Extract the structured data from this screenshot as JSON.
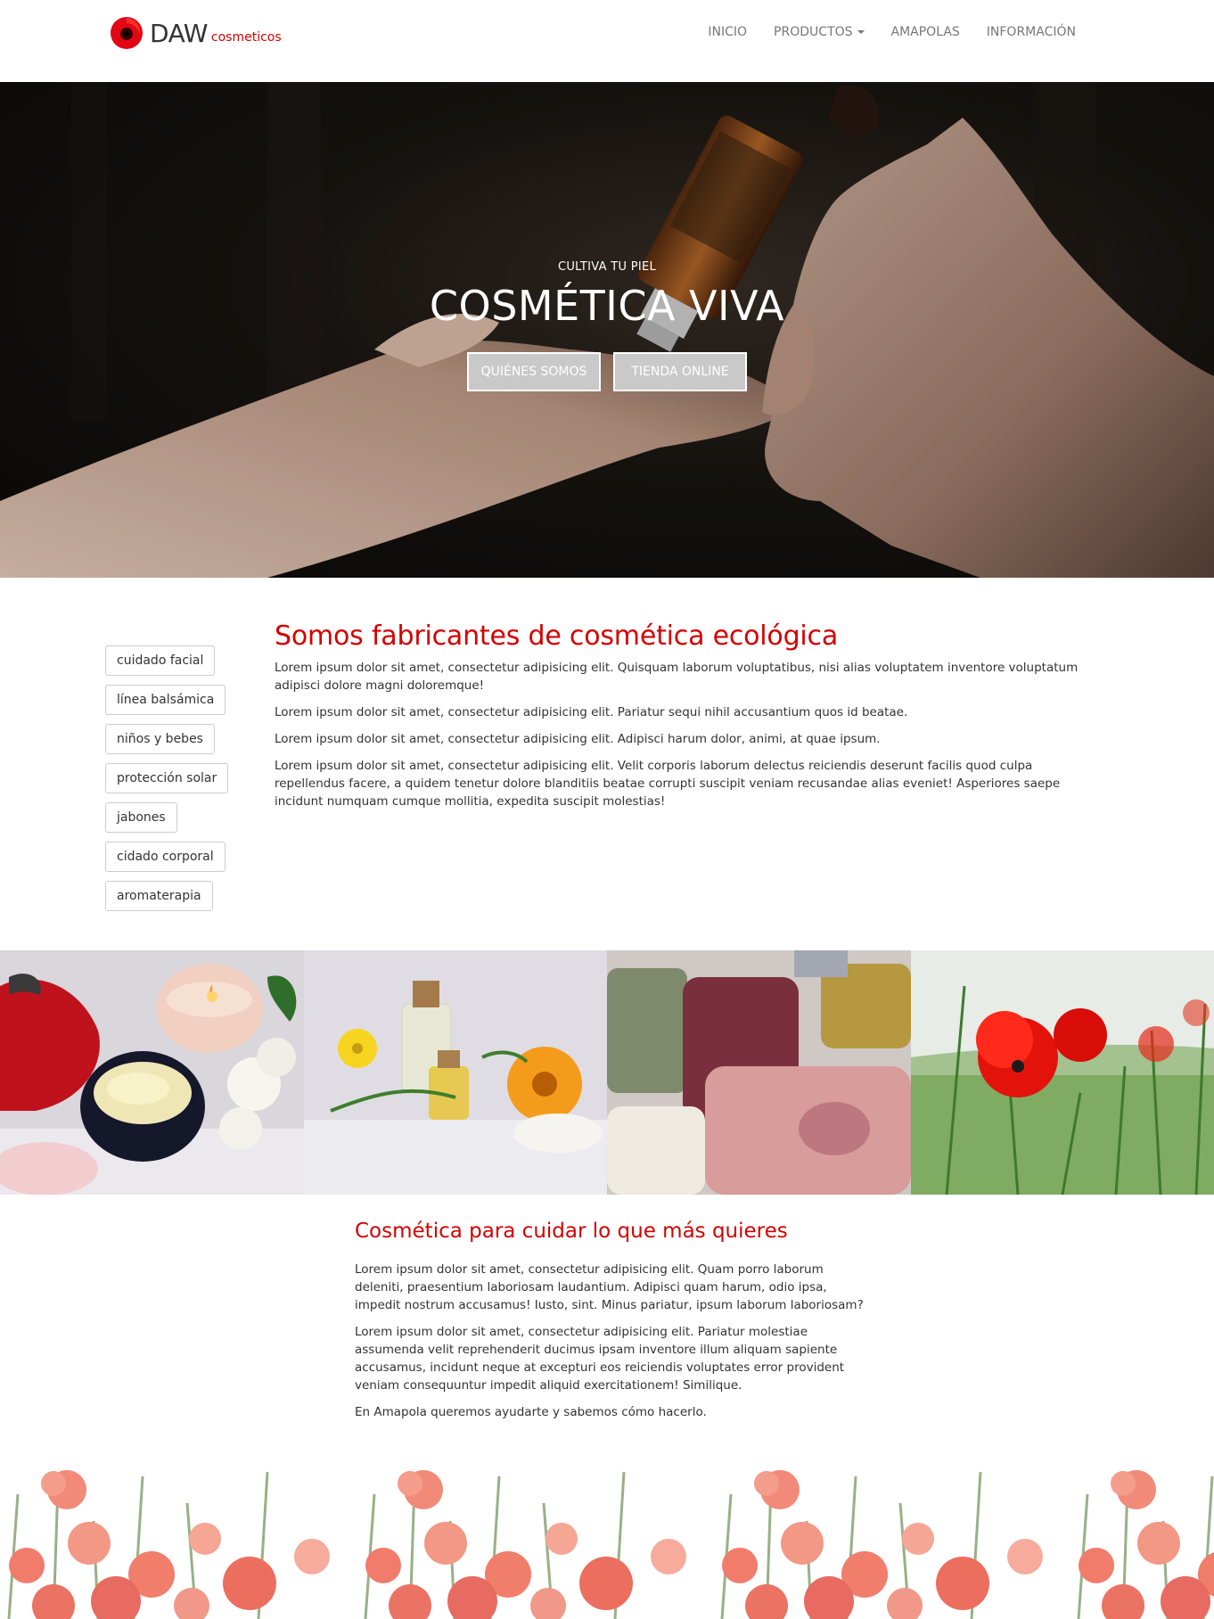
{
  "brand": {
    "name": "DAW",
    "sub": "cosmeticos"
  },
  "nav": {
    "items": [
      {
        "label": "INICIO"
      },
      {
        "label": "PRODUCTOS",
        "dropdown": true
      },
      {
        "label": "AMAPOLAS"
      },
      {
        "label": "INFORMACIÓN"
      }
    ]
  },
  "hero": {
    "kicker": "CULTIVA TU PIEL",
    "title": "COSMÉTICA VIVA",
    "buttons": [
      "QUIÉNES SOMOS",
      "TIENDA ONLINE"
    ]
  },
  "sidebar": {
    "tags": [
      "cuidado facial",
      "línea balsámica",
      "niños y bebes",
      "protección solar",
      "jabones",
      "cidado corporal",
      "aromaterapia"
    ]
  },
  "intro": {
    "title": "Somos fabricantes de cosmética ecológica",
    "paragraphs": [
      "Lorem ipsum dolor sit amet, consectetur adipisicing elit. Quisquam laborum voluptatibus, nisi alias voluptatem inventore voluptatum adipisci dolore magni doloremque!",
      "Lorem ipsum dolor sit amet, consectetur adipisicing elit. Pariatur sequi nihil accusantium quos id beatae.",
      "Lorem ipsum dolor sit amet, consectetur adipisicing elit. Adipisci harum dolor, animi, at quae ipsum.",
      "Lorem ipsum dolor sit amet, consectetur adipisicing elit. Velit corporis laborum delectus reiciendis deserunt facilis quod culpa repellendus facere, a quidem tenetur dolore blanditiis beatae corrupti suscipit veniam recusandae alias eveniet! Asperiores saepe incidunt numquam cumque mollitia, expedita suscipit molestias!"
    ]
  },
  "gallery": {
    "images": [
      "cream-jar-candle-photo",
      "calendula-oil-bottles-photo",
      "soap-bars-photo",
      "red-poppies-photo"
    ]
  },
  "cuidar": {
    "title": "Cosmética para cuidar lo que más quieres",
    "paragraphs": [
      "Lorem ipsum dolor sit amet, consectetur adipisicing elit. Quam porro laborum deleniti, praesentium laboriosam laudantium. Adipisci quam harum, odio ipsa, impedit nostrum accusamus! Iusto, sint. Minus pariatur, ipsum laborum laboriosam?",
      "Lorem ipsum dolor sit amet, consectetur adipisicing elit. Pariatur molestiae assumenda velit reprehenderit ducimus ipsam inventore illum aliquam sapiente accusamus, incidunt neque at excepturi eos reiciendis voluptates error provident veniam consequuntur impedit aliquid exercitationem! Similique.",
      "En Amapola queremos ayudarte y sabemos cómo hacerlo."
    ]
  },
  "colors": {
    "accent": "#d40000",
    "text": "#333333",
    "nav": "#777777"
  }
}
